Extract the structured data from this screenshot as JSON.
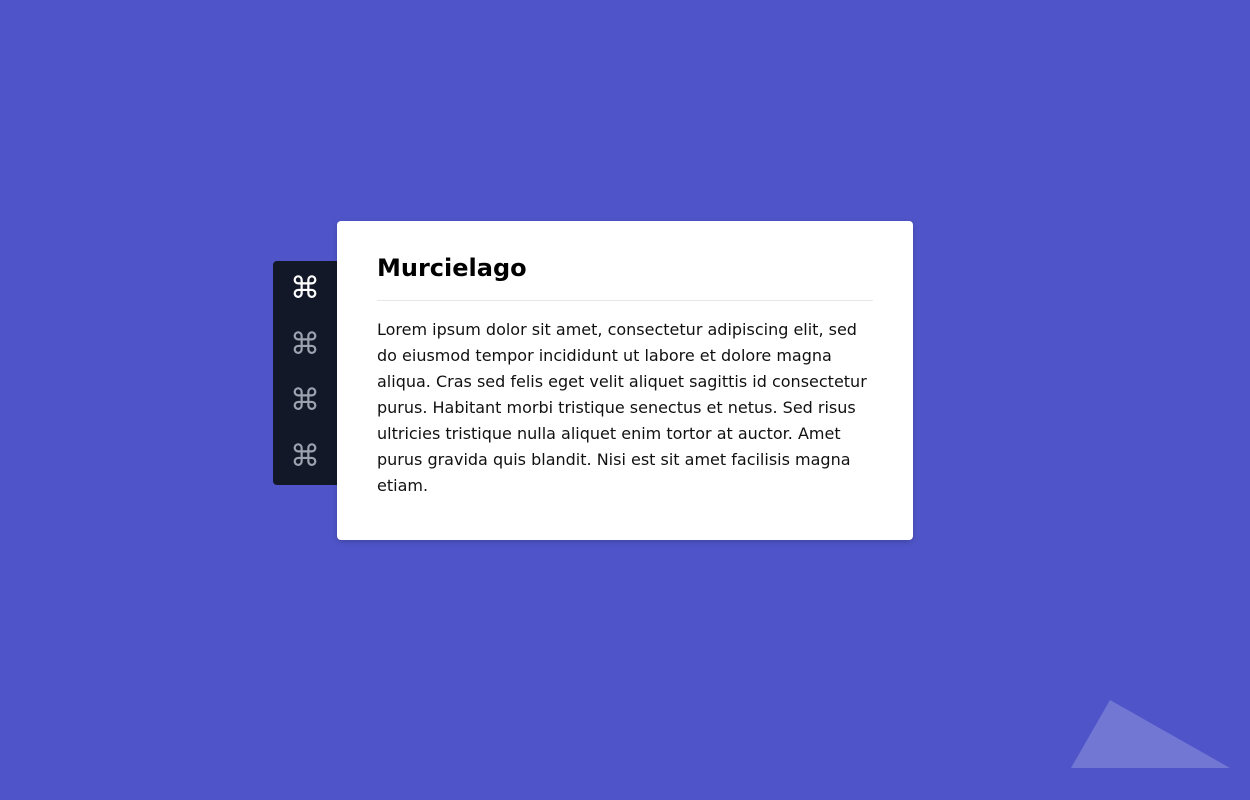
{
  "colors": {
    "background": "#4f55c9",
    "rail": "#121827",
    "card": "#ffffff",
    "icon_active": "#ffffff",
    "icon_inactive": "#9ca3af"
  },
  "tabs": [
    {
      "icon": "command-icon",
      "glyph": "⌘",
      "active": true
    },
    {
      "icon": "command-icon",
      "glyph": "⌘",
      "active": false
    },
    {
      "icon": "command-icon",
      "glyph": "⌘",
      "active": false
    },
    {
      "icon": "command-icon",
      "glyph": "⌘",
      "active": false
    }
  ],
  "card": {
    "title": "Murcielago",
    "body": "Lorem ipsum dolor sit amet, consectetur adipiscing elit, sed do eiusmod tempor incididunt ut labore et dolore magna aliqua. Cras sed felis eget velit aliquet sagittis id consectetur purus. Habitant morbi tristique senectus et netus. Sed risus ultricies tristique nulla aliquet enim tortor at auctor. Amet purus gravida quis blandit. Nisi est sit amet facilisis magna etiam."
  }
}
